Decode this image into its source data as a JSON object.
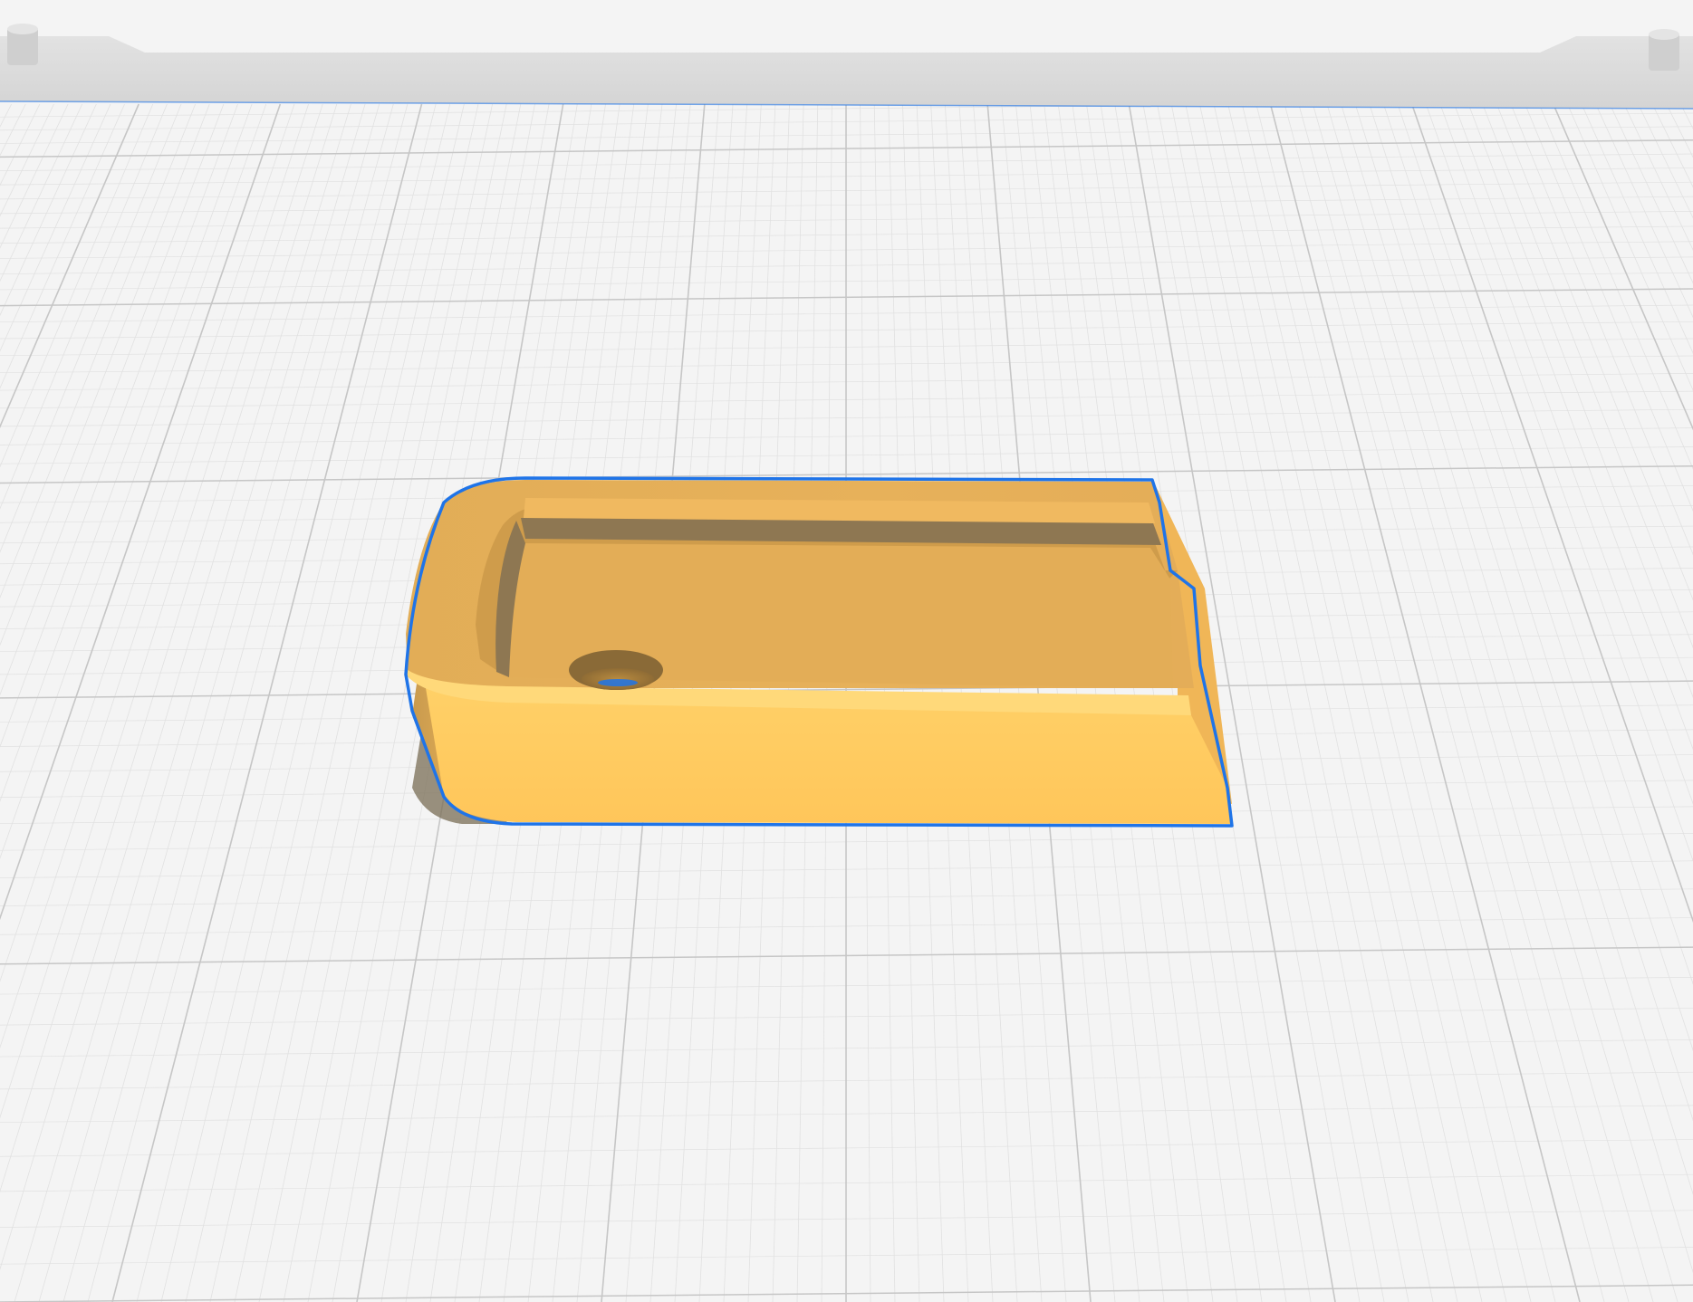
{
  "scene": {
    "background_color": "#f4f4f4",
    "grid_minor_color": "#e1e1e1",
    "grid_major_color": "#c6c6c6",
    "plate_frame_color": "#d9d9d9",
    "selection_outline_color": "#1f74e8",
    "model_color": "#ffc85c",
    "model_shadow_color": "#7a6d55",
    "model_selected": true,
    "icons": [
      "print-bed-frame",
      "selected-3d-model",
      "build-plate-grid"
    ]
  }
}
